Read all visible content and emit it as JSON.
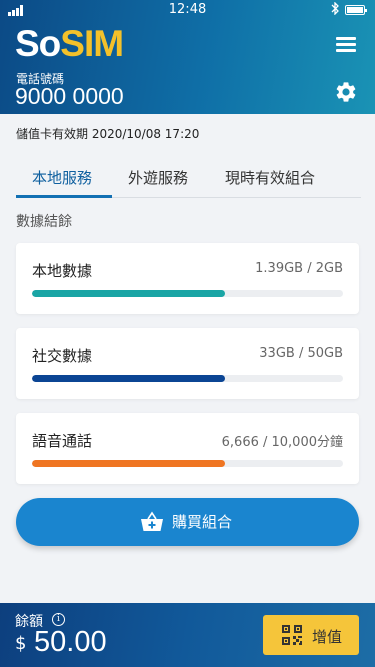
{
  "status_bar": {
    "time": "12:48"
  },
  "header": {
    "logo_so": "So",
    "logo_sim": "SIM",
    "phone_label": "電話號碼",
    "phone_number": "9000 0000"
  },
  "expiry_text": "儲值卡有效期 2020/10/08 17:20",
  "tabs": [
    {
      "label": "本地服務",
      "active": true
    },
    {
      "label": "外遊服務",
      "active": false
    },
    {
      "label": "現時有效組合",
      "active": false
    }
  ],
  "section_title": "數據結餘",
  "usage": [
    {
      "label": "本地數據",
      "value": "1.39GB / 2GB",
      "fraction": 0.62,
      "color": "#1aa5a5"
    },
    {
      "label": "社交數據",
      "value": "33GB / 50GB",
      "fraction": 0.62,
      "color": "#0b4594"
    },
    {
      "label": "語音通話",
      "value": "6,666 / 10,000分鐘",
      "fraction": 0.62,
      "color": "#ef7522"
    }
  ],
  "buy_button": {
    "label": "購買組合",
    "icon": "basket-plus-icon"
  },
  "footer": {
    "balance_label": "餘額",
    "info_icon": "i",
    "currency": "$",
    "balance": "50.00",
    "topup_label": "增值",
    "topup_icon": "qr-code-icon"
  },
  "colors": {
    "brand_yellow": "#f4c12a",
    "accent_blue": "#1270b3",
    "button_blue": "#1a85cf",
    "topup_yellow": "#f5c53a"
  }
}
